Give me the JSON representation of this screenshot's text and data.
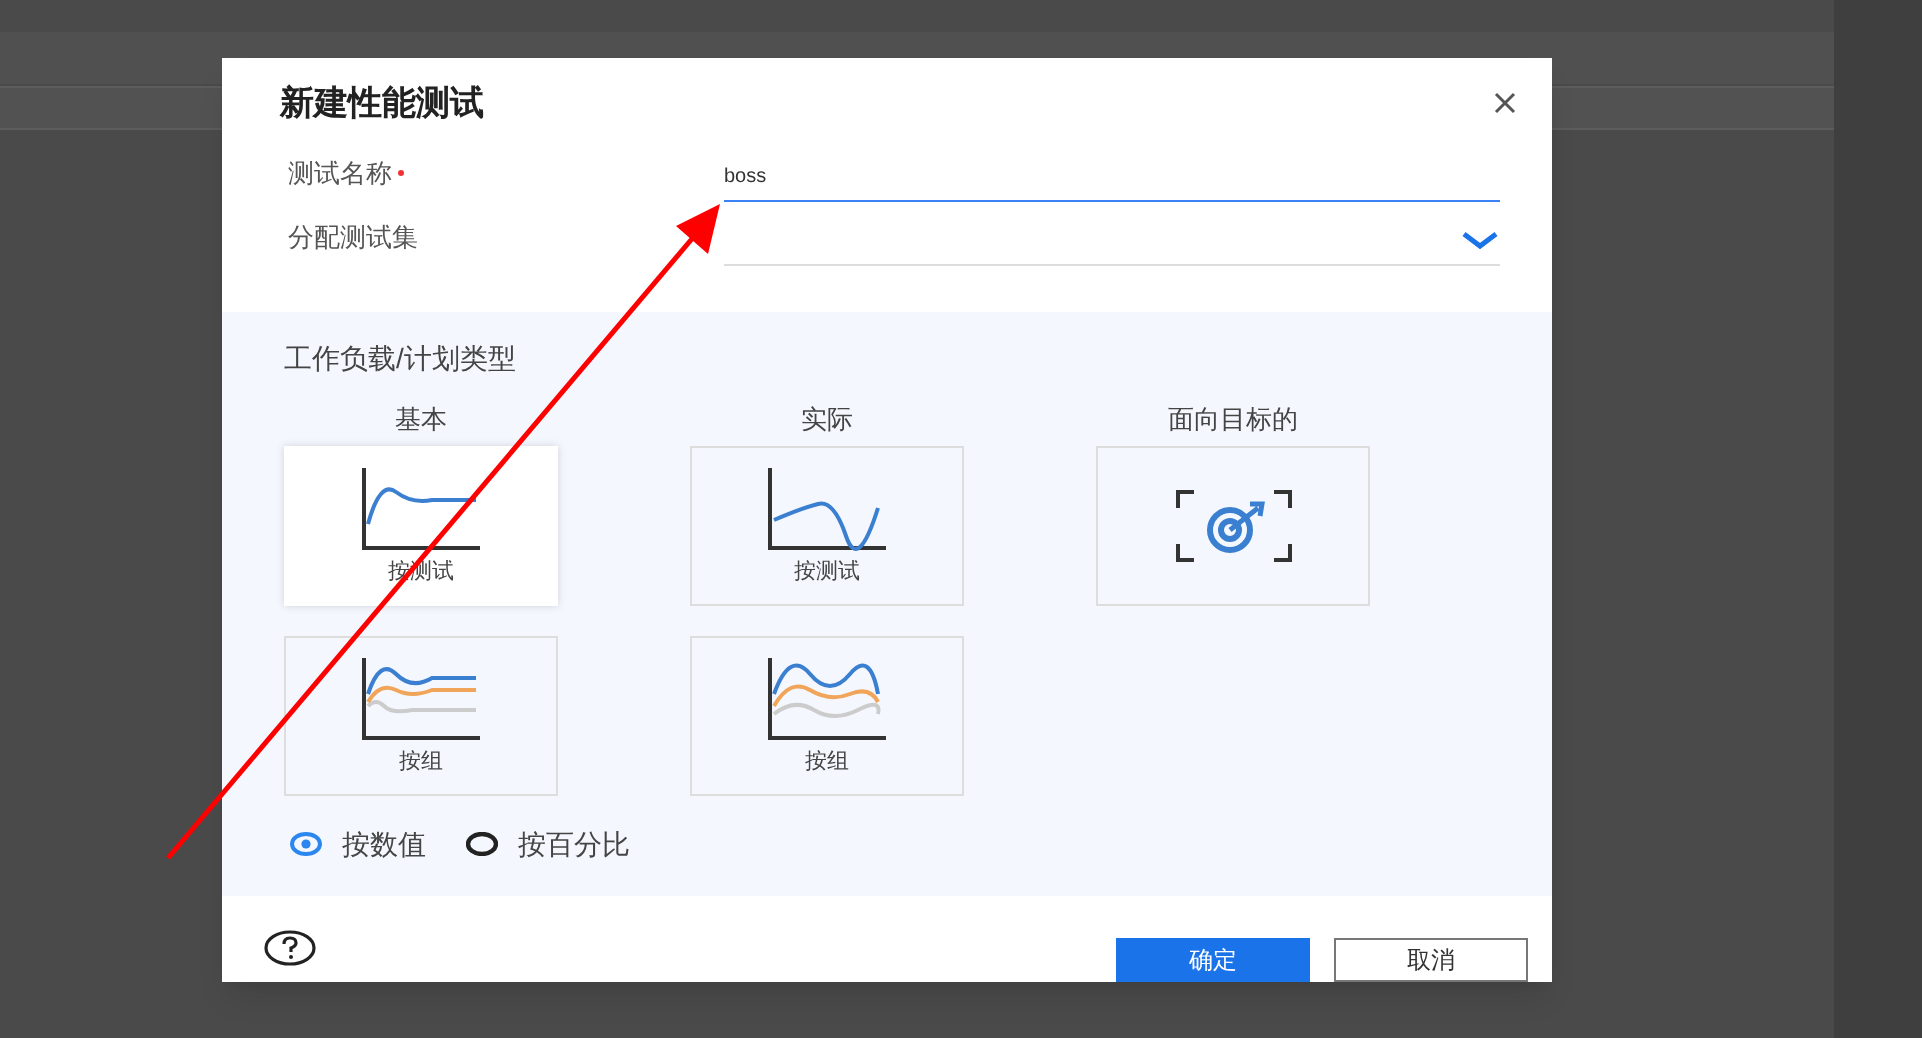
{
  "dialog": {
    "title": "新建性能测试",
    "fields": [
      {
        "kind": "text",
        "label": "测试名称",
        "required": true,
        "value": "boss"
      },
      {
        "kind": "select",
        "label": "分配测试集",
        "required": false
      }
    ],
    "section_title": "工作负载/计划类型",
    "groups": [
      {
        "label": "基本",
        "tiles": [
          {
            "kind": "flat",
            "caption": "按测试",
            "selected": true
          },
          {
            "kind": "flat-multi",
            "caption": "按组",
            "selected": false
          }
        ]
      },
      {
        "label": "实际",
        "tiles": [
          {
            "kind": "wave",
            "caption": "按测试",
            "selected": false
          },
          {
            "kind": "wave-multi",
            "caption": "按组",
            "selected": false
          }
        ]
      },
      {
        "label": "面向目标的",
        "tiles": [
          {
            "kind": "target",
            "selected": false
          }
        ]
      }
    ],
    "radios": [
      {
        "label": "按数值",
        "selected": true
      },
      {
        "label": "按百分比",
        "selected": false
      }
    ],
    "buttons": [
      {
        "kind": "primary",
        "label": "确定"
      },
      {
        "kind": "secondary",
        "label": "取消"
      }
    ]
  }
}
